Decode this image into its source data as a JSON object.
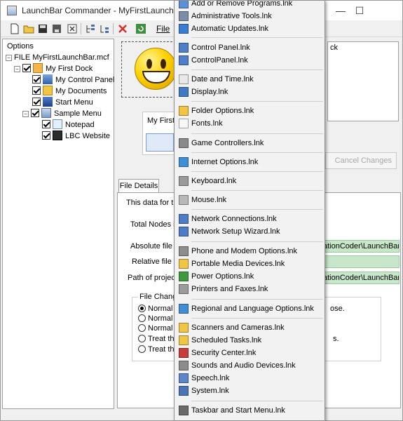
{
  "window": {
    "title": "LaunchBar Commander - MyFirstLaunchBar.m",
    "minimize": "—",
    "maximize": "☐"
  },
  "toolbar": {
    "file_menu": "File"
  },
  "tree": {
    "options": "Options",
    "file": "FILE MyFirstLaunchBar.mcf",
    "dock": "My First Dock",
    "items": [
      "My Control Panel",
      "My Documents",
      "Start Menu"
    ],
    "sample_menu": "Sample Menu",
    "sample_items": [
      "Notepad",
      "LBC Website"
    ]
  },
  "editor": {
    "notes_text": "ck",
    "preview_label": "My First",
    "cancel_button": "Cancel Changes"
  },
  "file_details": {
    "tab_label": "File Details",
    "description": "This data for this",
    "total_nodes_label": "Total Nodes in",
    "absolute_label": "Absolute file pa",
    "absolute_value": "ationCoder\\LaunchBar",
    "relative_label": "Relative file pa",
    "relative_value": "",
    "project_label": "Path of project f",
    "project_value": "ationCoder\\LaunchBar",
    "group_title": "File Changes",
    "radios": [
      "Normal file",
      "Normal file",
      "Normal file",
      "Treat the",
      "Treat the"
    ],
    "group_text_1": "ose.",
    "group_text_2": "s."
  },
  "menu": {
    "items": [
      {
        "label": "Add or Remove Programs.lnk",
        "icon": "programs-icon"
      },
      {
        "label": "Administrative Tools.lnk",
        "icon": "admin-tools-icon"
      },
      {
        "label": "Automatic Updates.lnk",
        "icon": "updates-icon"
      },
      {
        "label": "Control Panel.lnk",
        "icon": "control-panel-icon"
      },
      {
        "label": "ControlPanel.lnk",
        "icon": "control-panel-icon"
      },
      {
        "label": "Date and Time.lnk",
        "icon": "clock-icon"
      },
      {
        "label": "Display.lnk",
        "icon": "display-icon"
      },
      {
        "label": "Folder Options.lnk",
        "icon": "folder-icon"
      },
      {
        "label": "Fonts.lnk",
        "icon": "fonts-icon"
      },
      {
        "label": "Game Controllers.lnk",
        "icon": "gamepad-icon"
      },
      {
        "label": "Internet Options.lnk",
        "icon": "globe-icon"
      },
      {
        "label": "Keyboard.lnk",
        "icon": "keyboard-icon"
      },
      {
        "label": "Mouse.lnk",
        "icon": "mouse-icon"
      },
      {
        "label": "Network Connections.lnk",
        "icon": "network-icon"
      },
      {
        "label": "Network Setup Wizard.lnk",
        "icon": "network-icon"
      },
      {
        "label": "Phone and Modem Options.lnk",
        "icon": "phone-icon"
      },
      {
        "label": "Portable Media Devices.lnk",
        "icon": "folder-icon"
      },
      {
        "label": "Power Options.lnk",
        "icon": "power-icon"
      },
      {
        "label": "Printers and Faxes.lnk",
        "icon": "printer-icon"
      },
      {
        "label": "Regional and Language Options.lnk",
        "icon": "globe-icon"
      },
      {
        "label": "Scanners and Cameras.lnk",
        "icon": "folder-icon"
      },
      {
        "label": "Scheduled Tasks.lnk",
        "icon": "folder-icon"
      },
      {
        "label": "Security Center.lnk",
        "icon": "shield-icon"
      },
      {
        "label": "Sounds and Audio Devices.lnk",
        "icon": "speaker-icon"
      },
      {
        "label": "Speech.lnk",
        "icon": "speech-icon"
      },
      {
        "label": "System.lnk",
        "icon": "computer-icon"
      },
      {
        "label": "Taskbar and Start Menu.lnk",
        "icon": "taskbar-icon"
      }
    ]
  }
}
